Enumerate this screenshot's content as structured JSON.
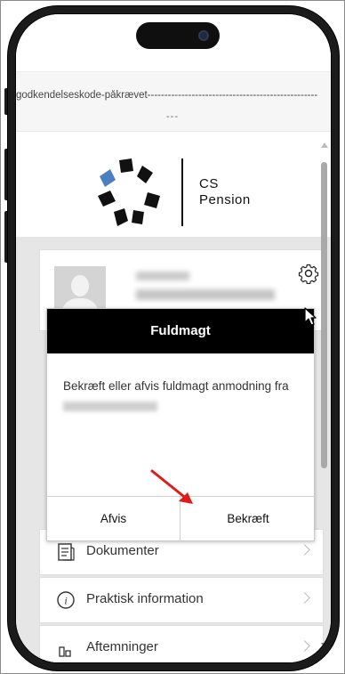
{
  "banner": {
    "code_text": "godkendelseskode-påkrævet--------------------------------------------------",
    "code_dashes": "---"
  },
  "brand": {
    "line1": "CS",
    "line2": "Pension",
    "logo_colors": [
      "#4a7fc1",
      "#111111"
    ]
  },
  "profile": {
    "settings_icon": "gear-icon"
  },
  "modal": {
    "title": "Fuldmagt",
    "message": "Bekræft eller afvis fuldmagt anmodning fra",
    "reject_label": "Afvis",
    "confirm_label": "Bekræft"
  },
  "menu": {
    "items": [
      {
        "label": "Dokumenter",
        "icon": "document-icon"
      },
      {
        "label": "Praktisk information",
        "icon": "info-icon"
      },
      {
        "label": "Aftemninger",
        "icon": "agreements-icon"
      }
    ]
  },
  "colors": {
    "modal_header": "#000000",
    "annotation_arrow": "#e01b1b",
    "logo_accent": "#4a7fc1"
  }
}
